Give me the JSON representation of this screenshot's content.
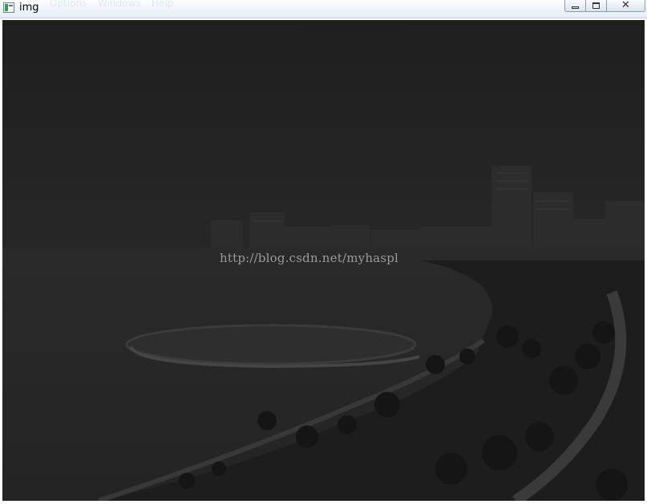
{
  "window": {
    "title": "img",
    "menu_ghost": [
      "Options",
      "Windows",
      "Help"
    ]
  },
  "image": {
    "watermark": "http://blog.csdn.net/myhaspl"
  },
  "colors": {
    "image_background": "#222222",
    "titlebar": "#eef3fa"
  },
  "icons": [
    "app-icon",
    "minimize-icon",
    "maximize-icon",
    "close-icon"
  ]
}
